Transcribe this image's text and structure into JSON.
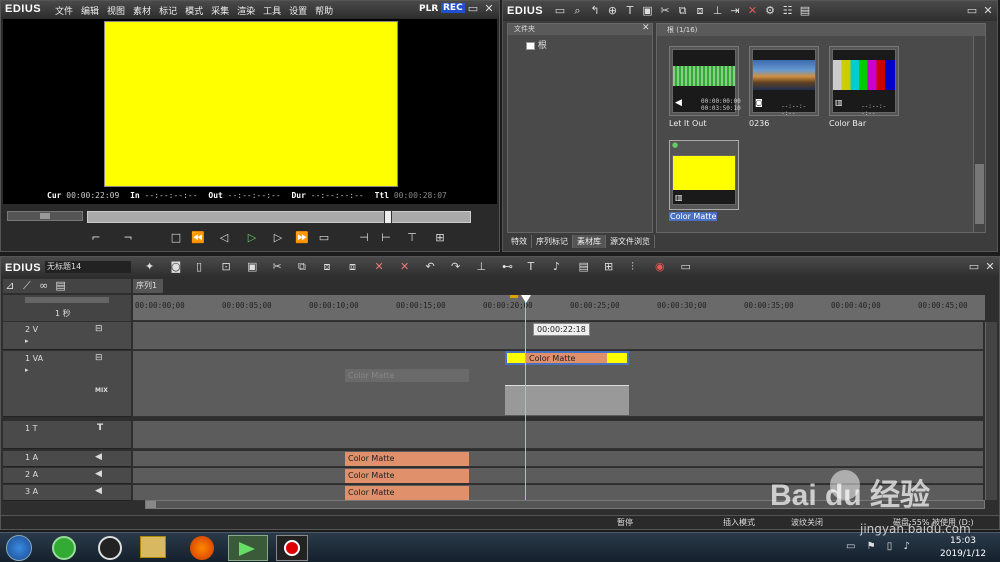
{
  "player": {
    "logo": "EDIUS",
    "menu": [
      "文件",
      "编辑",
      "视图",
      "素材",
      "标记",
      "模式",
      "采集",
      "渲染",
      "工具",
      "设置",
      "帮助"
    ],
    "plr": "PLR",
    "rec": "REC",
    "cur_label": "Cur",
    "cur_value": "00:00:22:09",
    "in_label": "In",
    "in_value": "--:--:--:--",
    "out_label": "Out",
    "out_value": "--:--:--:--",
    "dur_label": "Dur",
    "dur_value": "--:--:--:--",
    "ttl_label": "Ttl",
    "ttl_value": "00:00:28:07",
    "preview_color": "#ffff00"
  },
  "bin": {
    "logo": "EDIUS",
    "folder_title": "文件夹",
    "folder_root": "根",
    "bin_title": "根 (1/16)",
    "clips": [
      {
        "name": "Let It Out",
        "tc1": "00:00:00:00",
        "tc2": "00:03:50:10"
      },
      {
        "name": "0236",
        "tc1": "",
        "tc2": "--:--:--:--"
      },
      {
        "name": "Color Bar",
        "tc1": "",
        "tc2": "--:--:--:--"
      },
      {
        "name": "Color Matte",
        "tc1": "",
        "tc2": ""
      }
    ],
    "tabs": [
      "特效",
      "序列标记",
      "素材库",
      "源文件浏览"
    ]
  },
  "timeline": {
    "logo": "EDIUS",
    "project_name": "无标题14",
    "sequence_tab": "序列1",
    "scale": "1 秒",
    "ruler": [
      "00:00:00;00",
      "00:00:05;00",
      "00:00:10;00",
      "00:00:15;00",
      "00:00:20;00",
      "00:00:25;00",
      "00:00:30;00",
      "00:00:35;00",
      "00:00:40;00",
      "00:00:45;00"
    ],
    "playhead_tooltip": "00:00:22:18",
    "tracks": [
      {
        "name": "2 V"
      },
      {
        "name": "1 VA",
        "mix": "MIX"
      },
      {
        "name": "1 T"
      },
      {
        "name": "1 A"
      },
      {
        "name": "2 A"
      },
      {
        "name": "3 A"
      }
    ],
    "clip_label": "Color Matte",
    "status": [
      "暂停",
      "插入模式",
      "波纹关闭",
      "磁盘:55% 被使用 (D:)"
    ]
  },
  "taskbar": {
    "time": "15:03",
    "date": "2019/1/12"
  },
  "watermark": {
    "brand": "Bai du 经验",
    "url": "jingyan.baidu.com"
  },
  "colors": {
    "clip_orange": "#e0906a",
    "matte_yellow": "#ffff00",
    "rec_blue": "#2050d0",
    "playhead": "#7fd0e8"
  }
}
